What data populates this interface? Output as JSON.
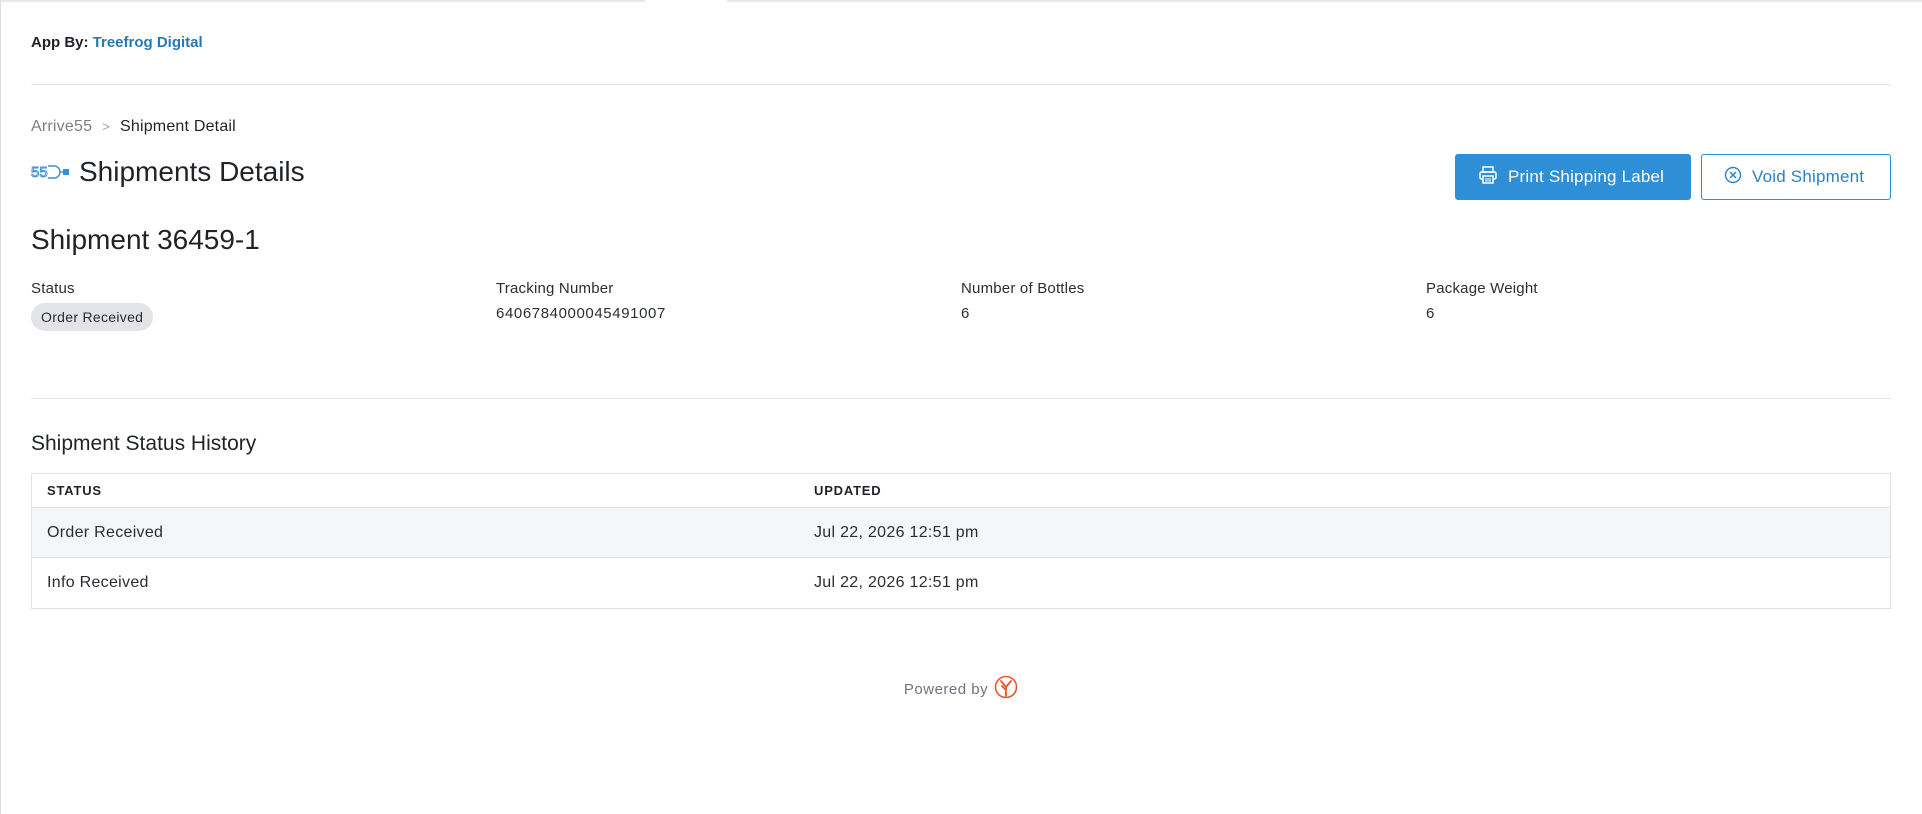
{
  "header": {
    "app_by_label": "App By:",
    "app_by_link": "Treefrog Digital"
  },
  "breadcrumb": {
    "root": "Arrive55",
    "separator": ">",
    "current": "Shipment Detail"
  },
  "page": {
    "logo_text": "55",
    "title": "Shipments Details"
  },
  "actions": {
    "print_label": "Print Shipping Label",
    "void_label": "Void Shipment"
  },
  "shipment": {
    "title": "Shipment 36459-1",
    "fields": {
      "status_label": "Status",
      "status_value": "Order Received",
      "tracking_label": "Tracking Number",
      "tracking_value": "6406784000045491007",
      "bottles_label": "Number of Bottles",
      "bottles_value": "6",
      "weight_label": "Package Weight",
      "weight_value": "6"
    }
  },
  "history": {
    "title": "Shipment Status History",
    "columns": [
      "STATUS",
      "UPDATED"
    ],
    "rows": [
      {
        "status": "Order Received",
        "updated": "Jul 22, 2026 12:51 pm"
      },
      {
        "status": "Info Received",
        "updated": "Jul 22, 2026 12:51 pm"
      }
    ]
  },
  "footer": {
    "powered_by": "Powered by"
  },
  "colors": {
    "primary": "#2f8fd6",
    "link": "#2878b5",
    "treefrog_logo": "#e8582b"
  },
  "icons": {
    "print": "printer-icon",
    "void": "circle-x-icon",
    "brand": "arrive55-logo",
    "powered": "treefrog-logo"
  }
}
